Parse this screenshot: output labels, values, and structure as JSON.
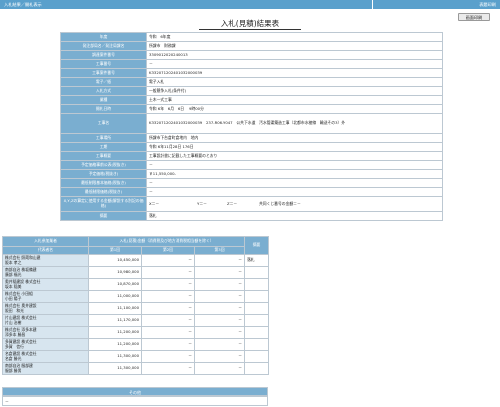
{
  "header": {
    "left_text": "入札結果／開札表示",
    "right_text": "表題印刷"
  },
  "print_button": "画面印刷",
  "page_title": "入札(見積)結果表",
  "info_rows": [
    {
      "label": "年度",
      "value": "令和　6年度"
    },
    {
      "label": "発注部局名／発注局課名",
      "value": "所課市　財務課"
    },
    {
      "label": "調達案件番号",
      "value": "3309012020240013"
    },
    {
      "label": "工事番号",
      "value": "－"
    },
    {
      "label": "工事案件番号",
      "value": "K332071202401032000039"
    },
    {
      "label": "電子／紙",
      "value": "電子入札"
    },
    {
      "label": "入札方式",
      "value": "一般競争入札(条件付)"
    },
    {
      "label": "業種",
      "value": "土木一式工事"
    },
    {
      "label": "開札日時",
      "value": "令和 6年　6月　6日　 9時00分"
    },
    {
      "label": "工事名",
      "value": "K332071202401032000039　237-R06-Y047　公共下水道　汚水管渠築造工事（北都市水稜線　輸送その3）外"
    },
    {
      "label": "工事場所",
      "value": "所課市下台倉町倉地内　地内"
    },
    {
      "label": "工期",
      "value": "令和 6年11月28日 176日"
    },
    {
      "label": "工事概要",
      "value": "工事設計書に記載した工事概要のとおり"
    },
    {
      "label": "予定価格事前公表(税抜き)",
      "value": "－"
    },
    {
      "label": "予定価格(税抜き)",
      "value": "￥11,550,000-"
    },
    {
      "label": "最低制限基本価格(税抜き)",
      "value": "－"
    },
    {
      "label": "最低制限価格(税抜き)",
      "value": "－"
    },
    {
      "label": "X,Y,Zの算定に使用する金額(解説する別記の価格)",
      "value_x": "X＝－",
      "value_y": "Y＝－",
      "value_z": "Z＝－",
      "value_note": "共同くじ番号の金額＝－"
    },
    {
      "label": "摘要",
      "value": "落札"
    }
  ],
  "bidders": {
    "col_company_group": "入札参加業者",
    "col_company": "代表者名",
    "col_amount_group": "入札(見積)金額（消費税及び地方消費税相当額を除く）",
    "col_round1": "第1回",
    "col_round2": "第2回",
    "col_round3": "第3回",
    "col_result": "摘要",
    "rows": [
      {
        "company": "株式会社 照蔵和山建",
        "rep": "阪本 孝之",
        "r1": "10,450,000",
        "r2": "－",
        "r3": "－",
        "result": "落札"
      },
      {
        "company": "南部自治 株坂備建",
        "rep": "廣部 福光",
        "r1": "10,980,000",
        "r2": "－",
        "r3": "－",
        "result": ""
      },
      {
        "company": "奥井稲建設 株式会社",
        "rep": "坂本 稲美",
        "r1": "10,870,000",
        "r2": "－",
        "r3": "－",
        "result": ""
      },
      {
        "company": "株式会社 小田組",
        "rep": "小田 陽子",
        "r1": "11,000,000",
        "r2": "－",
        "r3": "－",
        "result": ""
      },
      {
        "company": "株式会社 奥井建設",
        "rep": "阪田　和光",
        "r1": "11,100,000",
        "r2": "－",
        "r3": "－",
        "result": ""
      },
      {
        "company": "片山建設 株式会社",
        "rep": "片山 治樹",
        "r1": "11,170,000",
        "r2": "－",
        "r3": "－",
        "result": ""
      },
      {
        "company": "株式会社 添多本建",
        "rep": "添多本 勝昌",
        "r1": "11,200,000",
        "r2": "－",
        "r3": "－",
        "result": ""
      },
      {
        "company": "多賀建設 株式会社",
        "rep": "多賀　信行",
        "r1": "11,200,000",
        "r2": "－",
        "r3": "－",
        "result": ""
      },
      {
        "company": "名倉建設 株式会社",
        "rep": "名倉 勝光",
        "r1": "11,300,000",
        "r2": "－",
        "r3": "－",
        "result": ""
      },
      {
        "company": "南部自治 服部建",
        "rep": "服部 勝男",
        "r1": "11,300,000",
        "r2": "－",
        "r3": "－",
        "result": ""
      }
    ]
  },
  "other": {
    "heading": "その他",
    "value": "－"
  }
}
